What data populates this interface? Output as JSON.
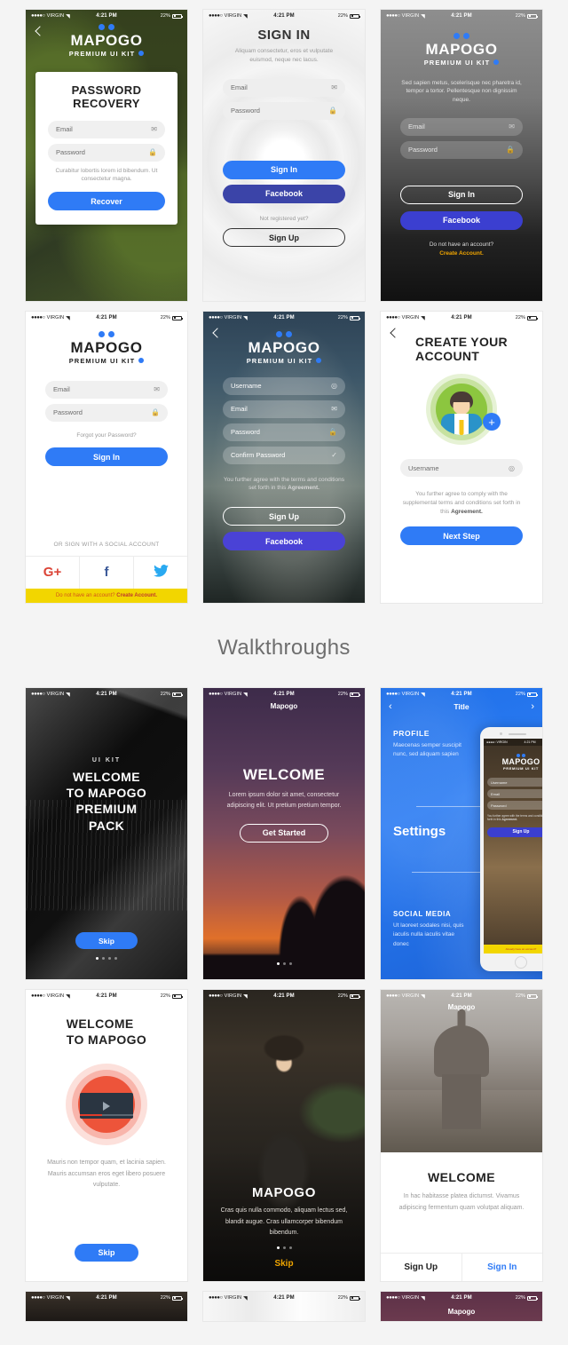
{
  "statusbar": {
    "carrier": "VIRGIN",
    "time": "4:21 PM",
    "battery": "22%",
    "dots": "●●●●○",
    "wifi": "▾"
  },
  "section": {
    "walkthroughs_title": "Walkthroughs"
  },
  "brand": {
    "name": "MAPOGO",
    "tagline": "PREMIUM UI KIT",
    "short": "Mapogo"
  },
  "screens": {
    "password_recovery": {
      "title_line1": "PASSWORD",
      "title_line2": "RECOVERY",
      "email_placeholder": "Email",
      "password_placeholder": "Password",
      "note": "Curabitur lobortis lorem id bibendum. Ut consectetur magna.",
      "button": "Recover"
    },
    "sign_in_light": {
      "title": "SIGN IN",
      "subtitle": "Aliquam consectetur, eros et vulputate euismod, neque nec lacus.",
      "email_placeholder": "Email",
      "password_placeholder": "Password",
      "signin": "Sign In",
      "facebook": "Facebook",
      "not_registered": "Not registered yet?",
      "signup": "Sign Up"
    },
    "sign_in_dark": {
      "description": "Sed sapien metus, scelerisque nec pharetra id, tempor a tortor. Pellentesque non dignissim neque.",
      "email_placeholder": "Email",
      "password_placeholder": "Password",
      "signin": "Sign In",
      "facebook": "Facebook",
      "no_account": "Do not have an account?",
      "create_account": "Create Account."
    },
    "sign_in_social": {
      "email_placeholder": "Email",
      "password_placeholder": "Password",
      "forgot": "Forgot your Password?",
      "signin": "Sign In",
      "or_social": "OR SIGN WITH A SOCIAL ACCOUNT",
      "google": "G+",
      "facebook": "f",
      "twitter": "t",
      "bar_text": "Do not have an account?",
      "bar_link": "Create Account."
    },
    "sign_up_photo": {
      "username_placeholder": "Username",
      "email_placeholder": "Email",
      "password_placeholder": "Password",
      "confirm_placeholder": "Confirm Password",
      "terms": "You further agree with the terms and conditions set forth in this ",
      "terms_link": "Agreement.",
      "signup": "Sign Up",
      "facebook": "Facebook"
    },
    "create_account": {
      "title_line1": "CREATE YOUR",
      "title_line2": "ACCOUNT",
      "username_placeholder": "Username",
      "terms": "You further agree to comply with the supplemental terms and conditions set forth in this ",
      "terms_link": "Agreement.",
      "button": "Next Step"
    },
    "walkthrough_building": {
      "kicker": "UI KIT",
      "line1": "WELCOME",
      "line2": "TO MAPOGO",
      "line3": "PREMIUM",
      "line4": "PACK",
      "button": "Skip"
    },
    "walkthrough_sunset": {
      "header": "Mapogo",
      "title": "WELCOME",
      "body": "Lorem ipsum dolor sit amet, consectetur adipiscing elit. Ut pretium pretium tempor.",
      "button": "Get Started"
    },
    "walkthrough_blue": {
      "header": "Title",
      "item1_title": "PROFILE",
      "item1_body": "Maecenas semper suscipit nunc, sed aliquam sapien",
      "item2_title": "Settings",
      "item3_title": "SOCIAL MEDIA",
      "item3_body": "Ut laoreet sodales nisi, quis iaculis nulla iaculis vitae donec",
      "inset_username": "Username",
      "inset_email": "Email",
      "inset_password": "Password",
      "inset_signup": "Sign Up"
    },
    "walkthrough_video": {
      "line1": "WELCOME",
      "line2": "TO MAPOGO",
      "body": "Mauris non tempor quam, et lacinia sapien. Mauris accumsan eros eget libero posuere vulputate.",
      "button": "Skip"
    },
    "walkthrough_woman": {
      "title": "MAPOGO",
      "body": "Cras quis nulla commodo, aliquam lectus sed, blandit augue. Cras ullamcorper bibendum bibendum.",
      "button": "Skip"
    },
    "walkthrough_dome": {
      "header": "Mapogo",
      "title": "WELCOME",
      "body": "In hac habitasse platea dictumst. Vivamus adipiscing fermentum quam volutpat aliquam.",
      "signup": "Sign Up",
      "signin": "Sign In"
    }
  },
  "colors": {
    "accent_blue": "#2f7bf6",
    "facebook_blue": "#3b44a8",
    "yellow_bar": "#f2d600",
    "google_red": "#db4437",
    "twitter_blue": "#29a9f1",
    "page_bg": "#f4f4f4"
  }
}
